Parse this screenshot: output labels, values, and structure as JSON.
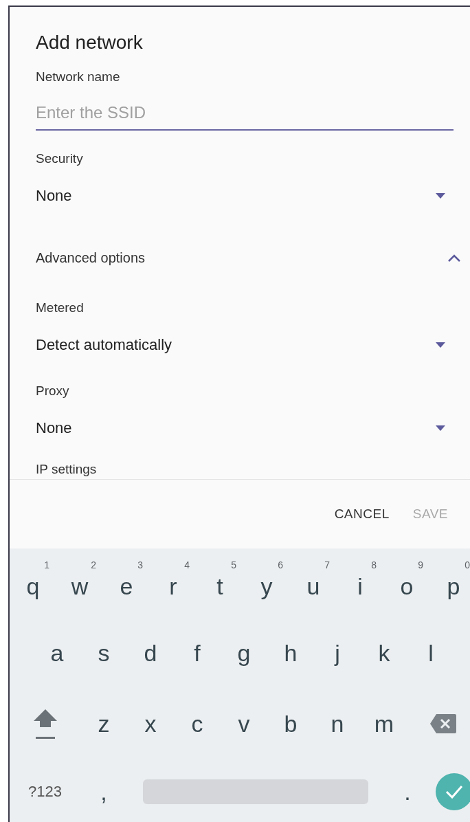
{
  "dialog": {
    "title": "Add network",
    "network_name": {
      "label": "Network name",
      "placeholder": "Enter the SSID"
    },
    "security": {
      "label": "Security",
      "value": "None"
    },
    "advanced": {
      "label": "Advanced options",
      "expanded": true
    },
    "fields": [
      {
        "label": "Metered",
        "value": "Detect automatically"
      },
      {
        "label": "Proxy",
        "value": "None"
      }
    ],
    "cut_label": "IP settings",
    "buttons": [
      {
        "label": "CANCEL",
        "disabled": false
      },
      {
        "label": "SAVE",
        "disabled": true
      }
    ]
  },
  "keyboard": {
    "rows": [
      [
        {
          "kind": "char",
          "key": "q",
          "hint": "1"
        },
        {
          "kind": "char",
          "key": "w",
          "hint": "2"
        },
        {
          "kind": "char",
          "key": "e",
          "hint": "3"
        },
        {
          "kind": "char",
          "key": "r",
          "hint": "4"
        },
        {
          "kind": "char",
          "key": "t",
          "hint": "5"
        },
        {
          "kind": "char",
          "key": "y",
          "hint": "6"
        },
        {
          "kind": "char",
          "key": "u",
          "hint": "7"
        },
        {
          "kind": "char",
          "key": "i",
          "hint": "8"
        },
        {
          "kind": "char",
          "key": "o",
          "hint": "9"
        },
        {
          "kind": "char",
          "key": "p",
          "hint": "0"
        }
      ],
      [
        {
          "kind": "char",
          "key": "a"
        },
        {
          "kind": "char",
          "key": "s"
        },
        {
          "kind": "char",
          "key": "d"
        },
        {
          "kind": "char",
          "key": "f"
        },
        {
          "kind": "char",
          "key": "g"
        },
        {
          "kind": "char",
          "key": "h"
        },
        {
          "kind": "char",
          "key": "j"
        },
        {
          "kind": "char",
          "key": "k"
        },
        {
          "kind": "char",
          "key": "l"
        }
      ],
      [
        {
          "kind": "shift"
        },
        {
          "kind": "char",
          "key": "z"
        },
        {
          "kind": "char",
          "key": "x"
        },
        {
          "kind": "char",
          "key": "c"
        },
        {
          "kind": "char",
          "key": "v"
        },
        {
          "kind": "char",
          "key": "b"
        },
        {
          "kind": "char",
          "key": "n"
        },
        {
          "kind": "char",
          "key": "m"
        },
        {
          "kind": "backspace"
        }
      ],
      [
        {
          "kind": "symbols",
          "key": "?123"
        },
        {
          "kind": "char",
          "key": ","
        },
        {
          "kind": "space"
        },
        {
          "kind": "char",
          "key": "."
        },
        {
          "kind": "enter"
        }
      ]
    ]
  }
}
